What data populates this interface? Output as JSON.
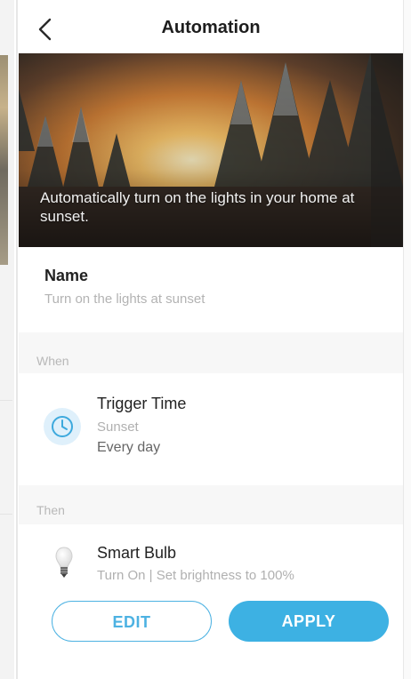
{
  "header": {
    "title": "Automation"
  },
  "hero": {
    "caption": "Automatically turn on the lights in your home at sunset."
  },
  "name_section": {
    "label": "Name",
    "value": "Turn on the lights at sunset"
  },
  "when_section": {
    "label": "When",
    "trigger": {
      "title": "Trigger Time",
      "subtitle": "Sunset",
      "repeat": "Every day"
    }
  },
  "then_section": {
    "label": "Then",
    "action": {
      "device": "Smart Bulb",
      "detail": "Turn On | Set brightness to 100%"
    }
  },
  "buttons": {
    "edit": "EDIT",
    "apply": "APPLY"
  },
  "colors": {
    "accent": "#3db1e3",
    "accent_light": "#dff0fb"
  },
  "icons": {
    "back": "chevron-left-icon",
    "trigger": "clock-icon",
    "device": "bulb-icon"
  }
}
